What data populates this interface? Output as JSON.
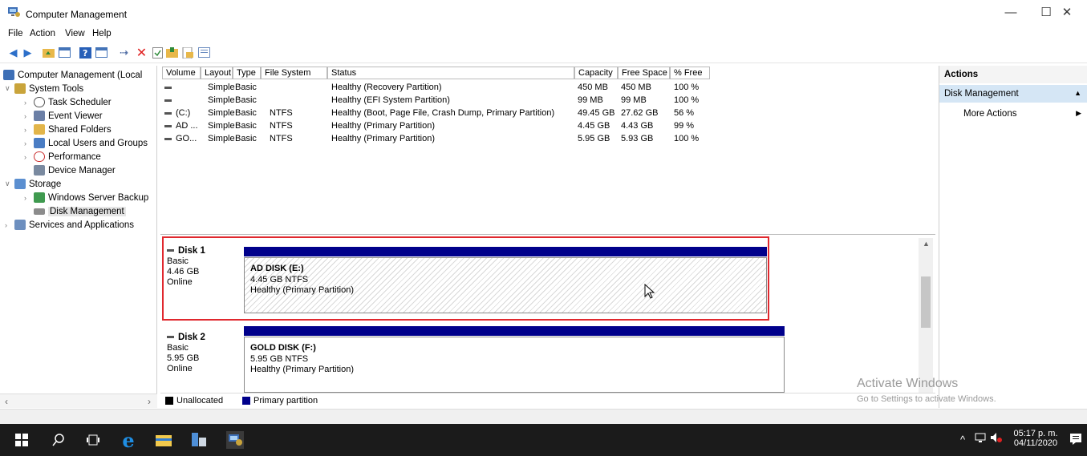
{
  "window": {
    "title": "Computer Management",
    "minimize_glyph": "—",
    "maximize_glyph": "☐",
    "close_glyph": "✕"
  },
  "menu": [
    "File",
    "Action",
    "View",
    "Help"
  ],
  "toolbar_icons": [
    "back-arrow-icon",
    "forward-arrow-icon",
    "up-folder-icon",
    "show-tree-icon",
    "properties-icon",
    "help-icon",
    "connect-icon",
    "delete-icon",
    "rescan-icon",
    "refresh-icon",
    "export-icon",
    "console-icon"
  ],
  "tree": {
    "root": "Computer Management (Local",
    "system_tools": "System Tools",
    "task_scheduler": "Task Scheduler",
    "event_viewer": "Event Viewer",
    "shared_folders": "Shared Folders",
    "local_users": "Local Users and Groups",
    "performance": "Performance",
    "device_manager": "Device Manager",
    "storage": "Storage",
    "wsb": "Windows Server Backup",
    "disk_management": "Disk Management",
    "services": "Services and Applications"
  },
  "volume_table": {
    "columns": [
      "Volume",
      "Layout",
      "Type",
      "File System",
      "Status",
      "Capacity",
      "Free Space",
      "% Free"
    ],
    "rows": [
      {
        "volume": "",
        "layout": "Simple",
        "type": "Basic",
        "fs": "",
        "status": "Healthy (Recovery Partition)",
        "capacity": "450 MB",
        "free": "450 MB",
        "pct": "100 %"
      },
      {
        "volume": "",
        "layout": "Simple",
        "type": "Basic",
        "fs": "",
        "status": "Healthy (EFI System Partition)",
        "capacity": "99 MB",
        "free": "99 MB",
        "pct": "100 %"
      },
      {
        "volume": "(C:)",
        "layout": "Simple",
        "type": "Basic",
        "fs": "NTFS",
        "status": "Healthy (Boot, Page File, Crash Dump, Primary Partition)",
        "capacity": "49.45 GB",
        "free": "27.62 GB",
        "pct": "56 %"
      },
      {
        "volume": "AD ...",
        "layout": "Simple",
        "type": "Basic",
        "fs": "NTFS",
        "status": "Healthy (Primary Partition)",
        "capacity": "4.45 GB",
        "free": "4.43 GB",
        "pct": "99 %"
      },
      {
        "volume": "GO...",
        "layout": "Simple",
        "type": "Basic",
        "fs": "NTFS",
        "status": "Healthy (Primary Partition)",
        "capacity": "5.95 GB",
        "free": "5.93 GB",
        "pct": "100 %"
      }
    ]
  },
  "disks": [
    {
      "name": "Disk 1",
      "type": "Basic",
      "size": "4.46 GB",
      "state": "Online",
      "partition_name": "AD DISK (E:)",
      "partition_size": "4.45 GB NTFS",
      "partition_status": "Healthy (Primary Partition)"
    },
    {
      "name": "Disk 2",
      "type": "Basic",
      "size": "5.95 GB",
      "state": "Online",
      "partition_name": "GOLD DISK (F:)",
      "partition_size": "5.95 GB NTFS",
      "partition_status": "Healthy (Primary Partition)"
    }
  ],
  "legend": {
    "unallocated": "Unallocated",
    "primary": "Primary partition",
    "unallocated_color": "#000000",
    "primary_color": "#00008b"
  },
  "actions": {
    "header": "Actions",
    "section": "Disk Management",
    "more": "More Actions"
  },
  "watermark": {
    "line1": "Activate Windows",
    "line2": "Go to Settings to activate Windows."
  },
  "taskbar": {
    "time": "05:17 p. m.",
    "date": "04/11/2020",
    "icons": [
      "windows-start-icon",
      "search-icon",
      "task-view-icon",
      "internet-explorer-icon",
      "file-explorer-icon",
      "server-manager-icon",
      "computer-management-icon"
    ]
  },
  "colors": {
    "selection_border": "#e0282e",
    "partition_bar": "#00008b",
    "actions_highlight": "#d5e6f5"
  }
}
